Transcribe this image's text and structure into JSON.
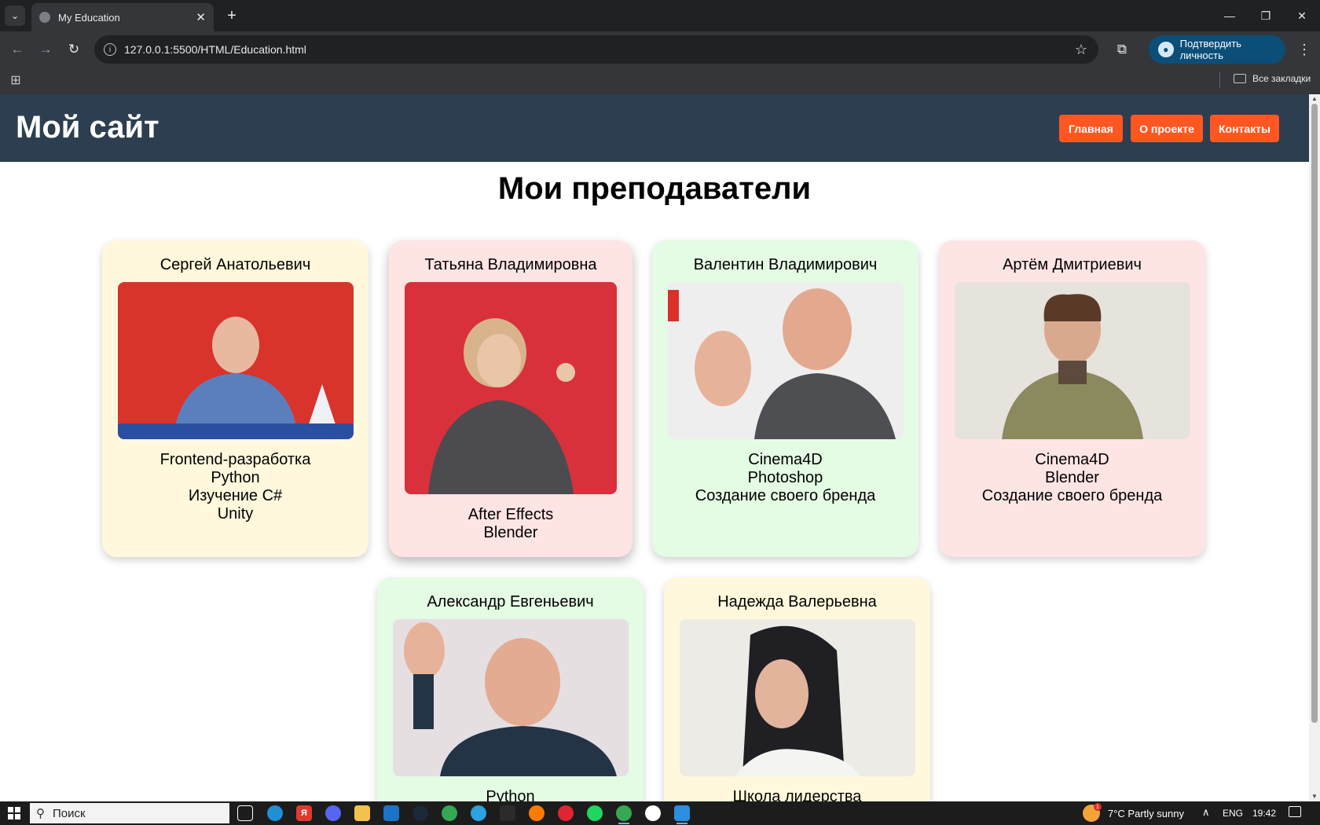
{
  "browser": {
    "tab_title": "My Education",
    "url": "127.0.0.1:5500/HTML/Education.html",
    "verify_label": "Подтвердить личность",
    "all_bookmarks": "Все закладки"
  },
  "site": {
    "title": "Мой сайт",
    "nav": [
      "Главная",
      "О проекте",
      "Контакты"
    ],
    "heading": "Мои преподаватели"
  },
  "teachers": [
    {
      "name": "Сергей Анатольевич",
      "skills": [
        "Frontend-разработка",
        "Python",
        "Изучение C#",
        "Unity"
      ],
      "bg": "#fff8dc",
      "photo_bg": "#d8342c"
    },
    {
      "name": "Татьяна Владимировна",
      "skills": [
        "After Effects",
        "Blender"
      ],
      "bg": "#ffe4e4",
      "photo_bg": "#d9313c"
    },
    {
      "name": "Валентин Владимирович",
      "skills": [
        "Cinema4D",
        "Photoshop",
        "Создание своего бренда"
      ],
      "bg": "#e4fbe4",
      "photo_bg": "#eeeeee"
    },
    {
      "name": "Артём Дмитриевич",
      "skills": [
        "Cinema4D",
        "Blender",
        "Создание своего бренда"
      ],
      "bg": "#ffe4e4",
      "photo_bg": "#e6e2dc"
    },
    {
      "name": "Александр Евгеньевич",
      "skills": [
        "Python"
      ],
      "bg": "#e4fbe4",
      "photo_bg": "#e6dfe2"
    },
    {
      "name": "Надежда Валерьевна",
      "skills": [
        "Школа лидерства"
      ],
      "bg": "#fff8dc",
      "photo_bg": "#ecebe6"
    }
  ],
  "taskbar": {
    "search_placeholder": "Поиск",
    "weather": "7°C  Partly sunny",
    "lang": "ENG",
    "time": "19:42"
  }
}
